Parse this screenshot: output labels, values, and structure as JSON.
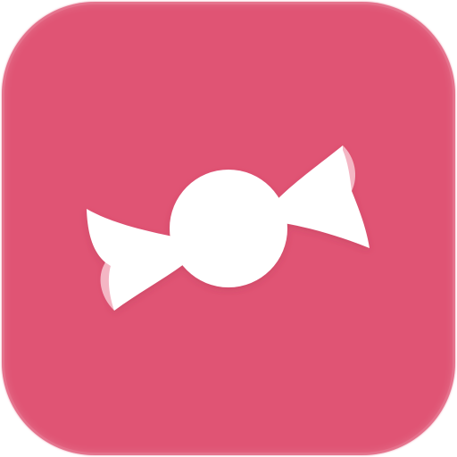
{
  "icon": {
    "name": "candy",
    "background_color": "#e05474",
    "glyph_color": "#ffffff",
    "highlight_color": "#f4b6c4"
  }
}
